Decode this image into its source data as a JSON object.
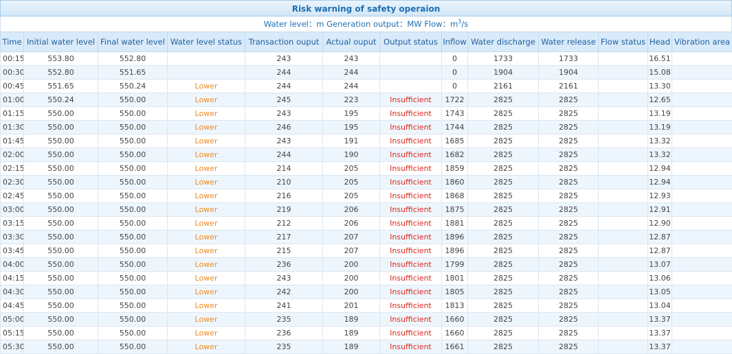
{
  "title": "Risk warning of safety operaion",
  "units": {
    "water_level_label": "Water level：",
    "water_level_unit": "m",
    "generation_label": "Generation output：",
    "generation_unit": "MW",
    "flow_label": "Flow：",
    "flow_unit_base": "m",
    "flow_unit_exp": "3",
    "flow_unit_tail": "/s"
  },
  "columns": [
    "Time",
    "Initial water level",
    "Final water level",
    "Water level status",
    "Transaction ouput",
    "Actual ouput",
    "Output status",
    "Inflow",
    "Water discharge",
    "Water release",
    "Flow status",
    "Head",
    "Vibration area"
  ],
  "rows": [
    [
      "00:15",
      "553.80",
      "552.80",
      "",
      "243",
      "243",
      "",
      "0",
      "1733",
      "1733",
      "",
      "16.51",
      ""
    ],
    [
      "00:30",
      "552.80",
      "551.65",
      "",
      "244",
      "244",
      "",
      "0",
      "1904",
      "1904",
      "",
      "15.08",
      ""
    ],
    [
      "00:45",
      "551.65",
      "550.24",
      "Lower",
      "244",
      "244",
      "",
      "0",
      "2161",
      "2161",
      "",
      "13.30",
      ""
    ],
    [
      "01:00",
      "550.24",
      "550.00",
      "Lower",
      "245",
      "223",
      "Insufficient",
      "1722",
      "2825",
      "2825",
      "",
      "12.65",
      ""
    ],
    [
      "01:15",
      "550.00",
      "550.00",
      "Lower",
      "243",
      "195",
      "Insufficient",
      "1743",
      "2825",
      "2825",
      "",
      "13.19",
      ""
    ],
    [
      "01:30",
      "550.00",
      "550.00",
      "Lower",
      "246",
      "195",
      "Insufficient",
      "1744",
      "2825",
      "2825",
      "",
      "13.19",
      ""
    ],
    [
      "01:45",
      "550.00",
      "550.00",
      "Lower",
      "243",
      "191",
      "Insufficient",
      "1685",
      "2825",
      "2825",
      "",
      "13.32",
      ""
    ],
    [
      "02:00",
      "550.00",
      "550.00",
      "Lower",
      "244",
      "190",
      "Insufficient",
      "1682",
      "2825",
      "2825",
      "",
      "13.32",
      ""
    ],
    [
      "02:15",
      "550.00",
      "550.00",
      "Lower",
      "214",
      "205",
      "Insufficient",
      "1859",
      "2825",
      "2825",
      "",
      "12.94",
      ""
    ],
    [
      "02:30",
      "550.00",
      "550.00",
      "Lower",
      "210",
      "205",
      "Insufficient",
      "1860",
      "2825",
      "2825",
      "",
      "12.94",
      ""
    ],
    [
      "02:45",
      "550.00",
      "550.00",
      "Lower",
      "216",
      "205",
      "Insufficient",
      "1868",
      "2825",
      "2825",
      "",
      "12.93",
      ""
    ],
    [
      "03:00",
      "550.00",
      "550.00",
      "Lower",
      "219",
      "206",
      "Insufficient",
      "1875",
      "2825",
      "2825",
      "",
      "12.91",
      ""
    ],
    [
      "03:15",
      "550.00",
      "550.00",
      "Lower",
      "212",
      "206",
      "Insufficient",
      "1881",
      "2825",
      "2825",
      "",
      "12.90",
      ""
    ],
    [
      "03:30",
      "550.00",
      "550.00",
      "Lower",
      "217",
      "207",
      "Insufficient",
      "1896",
      "2825",
      "2825",
      "",
      "12.87",
      ""
    ],
    [
      "03:45",
      "550.00",
      "550.00",
      "Lower",
      "215",
      "207",
      "Insufficient",
      "1896",
      "2825",
      "2825",
      "",
      "12.87",
      ""
    ],
    [
      "04:00",
      "550.00",
      "550.00",
      "Lower",
      "236",
      "200",
      "Insufficient",
      "1799",
      "2825",
      "2825",
      "",
      "13.07",
      ""
    ],
    [
      "04:15",
      "550.00",
      "550.00",
      "Lower",
      "243",
      "200",
      "Insufficient",
      "1801",
      "2825",
      "2825",
      "",
      "13.06",
      ""
    ],
    [
      "04:30",
      "550.00",
      "550.00",
      "Lower",
      "242",
      "200",
      "Insufficient",
      "1805",
      "2825",
      "2825",
      "",
      "13.05",
      ""
    ],
    [
      "04:45",
      "550.00",
      "550.00",
      "Lower",
      "241",
      "201",
      "Insufficient",
      "1813",
      "2825",
      "2825",
      "",
      "13.04",
      ""
    ],
    [
      "05:00",
      "550.00",
      "550.00",
      "Lower",
      "235",
      "189",
      "Insufficient",
      "1660",
      "2825",
      "2825",
      "",
      "13.37",
      ""
    ],
    [
      "05:15",
      "550.00",
      "550.00",
      "Lower",
      "236",
      "189",
      "Insufficient",
      "1660",
      "2825",
      "2825",
      "",
      "13.37",
      ""
    ],
    [
      "05:30",
      "550.00",
      "550.00",
      "Lower",
      "235",
      "189",
      "Insufficient",
      "1661",
      "2825",
      "2825",
      "",
      "13.37",
      ""
    ]
  ],
  "colors": {
    "title_text": "#1f6fb2",
    "header_bg": "#d9ebfa",
    "lower_status": "#ee8a1e",
    "insufficient_status": "#d9261c",
    "stripe_bg": "#eef6fd"
  }
}
